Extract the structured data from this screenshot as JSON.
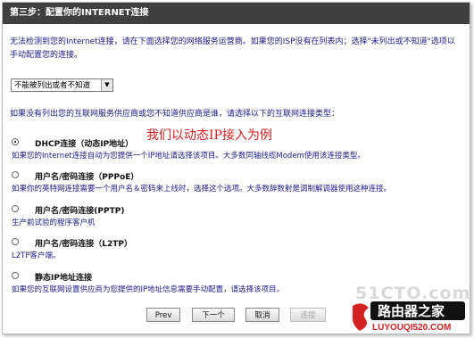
{
  "window": {
    "title": "第三步：配置你的INTERNET连接"
  },
  "intro_text": "无法检测到您的Internet连接，请在下面选择您的网络服务运营商。如果您的ISP没有在列表内；选择\"未列出或不知道\"选项以手动配置您的连接。",
  "isp_select": {
    "selected": "不能被列出或者不知道"
  },
  "prompt_text": "如果没有列出您的互联网服务供应商或您不知道供应商是谁，请选择以下的互联网连接类型：",
  "annotation": "我们以动态IP接入为例",
  "options": [
    {
      "label": "DHCP连接（动态IP地址）",
      "desc": "如果您的Internet连接自动为您提供一个IP地址请选择该项目。大多数同轴线缆Modem使用该连接类型。",
      "checked": true
    },
    {
      "label": "用户名/密码连接（PPPoE）",
      "desc": "如果你的英特网连接需要一个用户名＆密码来上线时，选择这个选项。大多数辞数射是调制解调器使用这种连接。",
      "checked": false
    },
    {
      "label": "用户名/密码连接(PPTP)",
      "desc": "生产前试验的程序客户机",
      "checked": false
    },
    {
      "label": "用户名/密码连接（L2TP）",
      "desc": "L2TP客户端。",
      "checked": false
    },
    {
      "label": "静态IP地址连接",
      "desc": "如果您的互联网设置供应商为您提供的IP地址信息需要手动配置，请选择该项目。",
      "checked": false
    }
  ],
  "buttons": {
    "prev": "Prev",
    "next": "下一个",
    "cancel": "取消",
    "connect": "连接"
  },
  "watermark": {
    "site_top": "51CTO.com",
    "brand": "路由器之家",
    "url": "LUYOUQI520.COM",
    "accent_color": "#d42222"
  }
}
